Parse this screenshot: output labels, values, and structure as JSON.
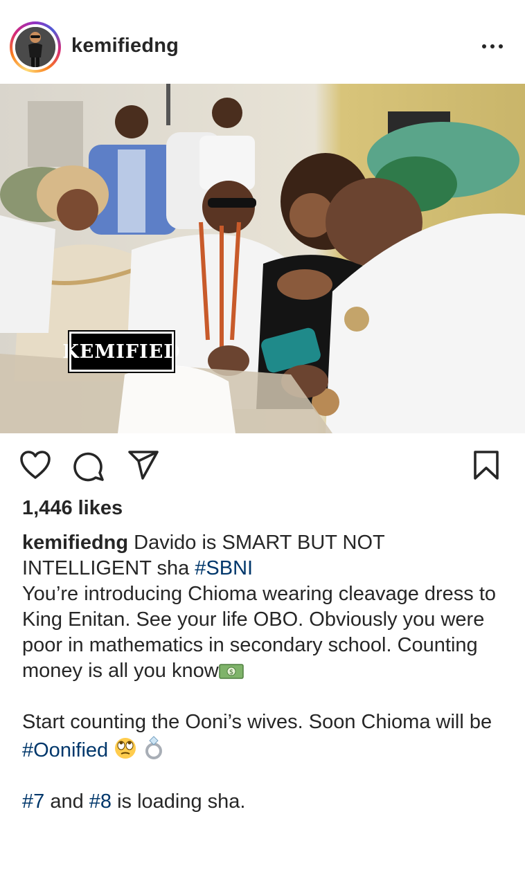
{
  "post": {
    "username": "kemifiedng",
    "more_icon": "more-horizontal-icon",
    "watermark": "KEMIFIED",
    "likes": "1,446 likes",
    "caption": {
      "username": "kemifiedng",
      "line1": " Davido is SMART BUT NOT INTELLIGENT sha ",
      "tag_sbni": "#SBNI",
      "para2": "You’re introducing Chioma wearing cleavage dress to King Enitan. See your life OBO. Obviously you were poor in mathematics in secondary school. Counting money is all you know",
      "para3_a": "Start counting the Ooni’s wives. Soon Chioma will be ",
      "tag_oonified": "#Oonified",
      "para4_tag7": "#7",
      "para4_and": " and ",
      "para4_tag8": "#8",
      "para4_end": " is loading sha."
    }
  },
  "icons": [
    "heart-icon",
    "comment-icon",
    "share-icon",
    "bookmark-icon",
    "money-emoji",
    "eyeroll-emoji",
    "ring-emoji"
  ],
  "colors": {
    "hashtag": "#00376b",
    "text": "#262626"
  }
}
